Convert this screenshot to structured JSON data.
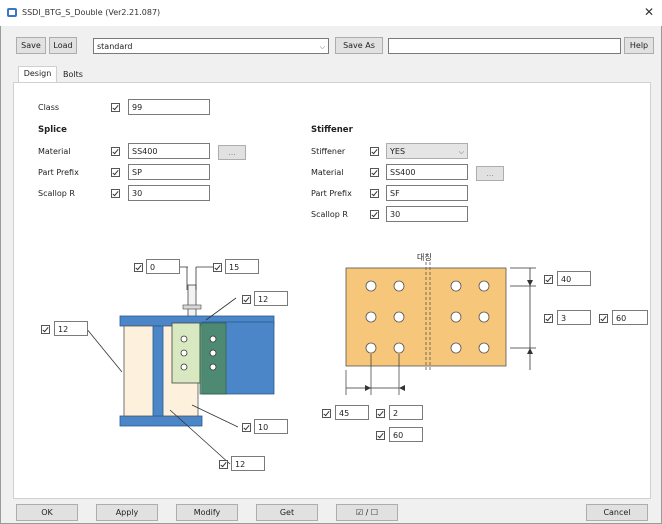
{
  "window": {
    "title": "SSDI_BTG_S_Double (Ver2.21.087)"
  },
  "toolbar": {
    "save_label": "Save",
    "load_label": "Load",
    "preset_value": "standard",
    "save_as_label": "Save As",
    "save_as_value": "",
    "help_label": "Help"
  },
  "tabs": [
    {
      "label": "Design"
    },
    {
      "label": "Bolts"
    }
  ],
  "class_field": {
    "label": "Class",
    "value": "99"
  },
  "splice": {
    "heading": "Splice",
    "material": {
      "label": "Material",
      "value": "SS400",
      "browse_label": "..."
    },
    "part_prefix": {
      "label": "Part Prefix",
      "value": "SP"
    },
    "scallop_r": {
      "label": "Scallop R",
      "value": "30"
    }
  },
  "stiffener": {
    "heading": "Stiffener",
    "stiffener": {
      "label": "Stiffener",
      "value": "YES"
    },
    "material": {
      "label": "Material",
      "value": "SS400",
      "browse_label": "..."
    },
    "part_prefix": {
      "label": "Part Prefix",
      "value": "SF"
    },
    "scallop_r": {
      "label": "Scallop R",
      "value": "30"
    }
  },
  "diagram_left": {
    "top_gap": "0",
    "top_offset": "15",
    "plate_thk": "12",
    "left_gap": "12",
    "bottom_val": "10",
    "bottom_gap": "12"
  },
  "diagram_right": {
    "label": "대칭",
    "edge_top": "40",
    "rows": "3",
    "row_pitch": "60",
    "edge_left": "45",
    "cols": "2",
    "col_pitch": "60"
  },
  "footer": {
    "ok_label": "OK",
    "apply_label": "Apply",
    "modify_label": "Modify",
    "get_label": "Get",
    "toggle_label": "☑ / ☐",
    "cancel_label": "Cancel"
  },
  "colors": {
    "plate_blue": "#4a86c8",
    "web_tan": "#fdf0dc",
    "splice_green": "#d8e8c0",
    "splice_plate": "#f6c67a"
  }
}
